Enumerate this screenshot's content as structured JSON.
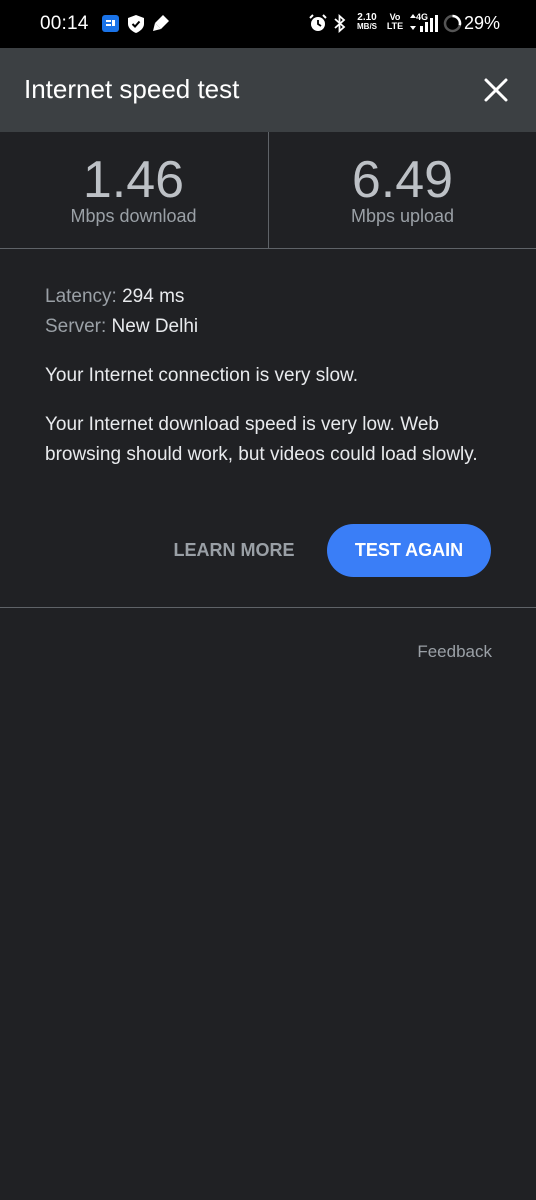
{
  "status_bar": {
    "time": "00:14",
    "net_speed_value": "2.10",
    "net_speed_unit": "MB/S",
    "volte_top": "Vo",
    "volte_bottom": "LTE",
    "network_type": "4G",
    "battery_percent": "29%"
  },
  "header": {
    "title": "Internet speed test",
    "close_icon": "close-icon"
  },
  "metrics": {
    "download": {
      "value": "1.46",
      "unit": "Mbps download"
    },
    "upload": {
      "value": "6.49",
      "unit": "Mbps upload"
    }
  },
  "details": {
    "latency_label": "Latency:",
    "latency_value": "294 ms",
    "server_label": "Server:",
    "server_value": "New Delhi"
  },
  "result": {
    "summary": "Your Internet connection is very slow.",
    "description": "Your Internet download speed is very low. Web browsing should work, but videos could load slowly."
  },
  "actions": {
    "learn_more_label": "LEARN MORE",
    "test_again_label": "TEST AGAIN"
  },
  "footer": {
    "feedback_label": "Feedback"
  },
  "colors": {
    "background": "#202124",
    "header": "#3c4043",
    "accent_button": "#3a7ef7",
    "status_bar": "#000000"
  }
}
